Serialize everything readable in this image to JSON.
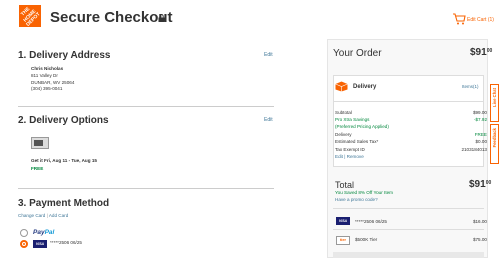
{
  "header": {
    "logo_text": "THE HOME DEPOT",
    "title": "Secure Checkout",
    "edit_cart": "Edit Cart (1)"
  },
  "delivery_address": {
    "heading": "1. Delivery Address",
    "edit": "Edit",
    "name": "Chris Nicholas",
    "street": "811 Valley Dr",
    "city": "DUNBAR, WV 25064",
    "phone": "(304) 395-0041"
  },
  "delivery_options": {
    "heading": "2. Delivery Options",
    "edit": "Edit",
    "date": "Get it Fri, Aug 11 - Tue, Aug 15",
    "cost": "FREE"
  },
  "payment": {
    "heading": "3. Payment Method",
    "change_card": "Change Card",
    "separator": "|",
    "add_card": "Add Card",
    "paypal_1": "Pay",
    "paypal_2": "Pal",
    "card_brand": "VISA",
    "card_number": "*****2506 06/25"
  },
  "order": {
    "title": "Your Order",
    "total_top_int": "$91",
    "total_top_dec": "00",
    "delivery_label": "Delivery",
    "items_link": "Items(1)",
    "rows": [
      {
        "label": "Subtotal",
        "value": "$99.00"
      },
      {
        "label": "Pro Xtra Savings",
        "value": "-$7.92"
      },
      {
        "label": "(Preferred Pricing Applied)",
        "value": ""
      },
      {
        "label": "Delivery",
        "value": "FREE"
      },
      {
        "label": "Estimated Sales Tax*",
        "value": "$0.00"
      },
      {
        "label": "Tax Exempt ID",
        "value": "2103184013"
      },
      {
        "label": "Edit | Remove",
        "value": ""
      }
    ],
    "total_label": "Total",
    "total_int": "$91",
    "total_dec": "00",
    "savings_text": "You Saved 8% Off Your Item",
    "promo_text": "Have a promo code?",
    "payments": [
      {
        "brand": "VISA",
        "number": "*****2506",
        "exp": "06/25",
        "amount": "$16.00"
      },
      {
        "brand": "$500K Tier",
        "number": "$500K Tier",
        "exp": "",
        "amount": "$75.00"
      }
    ]
  },
  "side_tabs": {
    "live_chat": "Live Chat",
    "feedback": "Feedback"
  },
  "colors": {
    "brand_orange": "#f96302",
    "link_blue": "#3e7697",
    "savings_green": "#00873c"
  }
}
